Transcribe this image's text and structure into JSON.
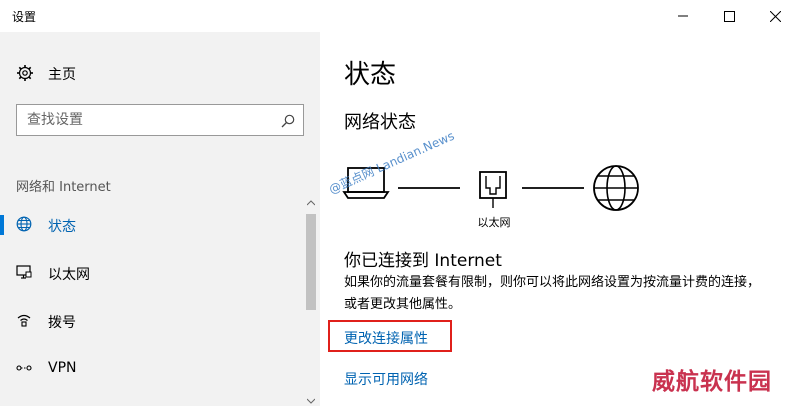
{
  "window": {
    "title": "设置"
  },
  "sidebar": {
    "home_label": "主页",
    "search": {
      "placeholder": "查找设置",
      "value": ""
    },
    "section_label": "网络和 Internet",
    "items": [
      {
        "label": "状态",
        "icon": "globe-icon",
        "active": true
      },
      {
        "label": "以太网",
        "icon": "ethernet-monitor-icon",
        "active": false
      },
      {
        "label": "拨号",
        "icon": "dialup-icon",
        "active": false
      },
      {
        "label": "VPN",
        "icon": "vpn-icon",
        "active": false
      }
    ]
  },
  "main": {
    "page_title": "状态",
    "section_title": "网络状态",
    "diagram": {
      "adapter_label": "以太网"
    },
    "connected_title": "你已连接到 Internet",
    "description": "如果你的流量套餐有限制，则你可以将此网络设置为按流量计费的连接，或者更改其他属性。",
    "links": {
      "change_properties": "更改连接属性",
      "show_networks": "显示可用网络"
    }
  },
  "overlay": {
    "watermark_text": "@蓝点网 Landian.News",
    "corner_logo_text": "威航软件园"
  },
  "colors": {
    "accent": "#0078d7",
    "link": "#0063b1",
    "highlight": "#e0201b",
    "sidebar_bg": "#f2f2f2"
  }
}
